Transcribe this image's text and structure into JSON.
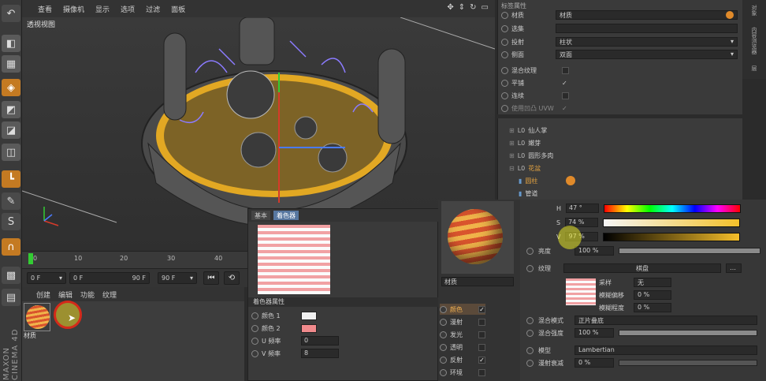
{
  "viewport": {
    "menu": [
      "查看",
      "摄像机",
      "显示",
      "选项",
      "过滤",
      "面板"
    ],
    "label": "透视视图"
  },
  "timeline": {
    "ticks": [
      "0",
      "10",
      "20",
      "30",
      "40"
    ],
    "start_field": "0 F",
    "mid_field_left": "0 F",
    "mid_field_right": "90 F",
    "end_field": "90 F"
  },
  "material_manager": {
    "menu": [
      "创建",
      "编辑",
      "功能",
      "纹理"
    ],
    "material_name": "材质"
  },
  "shader": {
    "tabs": [
      "基本",
      "着色器"
    ],
    "section": "着色器属性",
    "rows": [
      {
        "label": "颜色 1",
        "color": "#f0f0f0"
      },
      {
        "label": "颜色 2",
        "color": "#f08a8c"
      },
      {
        "label": "U 频率",
        "value": "0"
      },
      {
        "label": "V 频率",
        "value": "8"
      }
    ]
  },
  "mat_editor": {
    "name": "材质",
    "channels": [
      {
        "label": "颜色",
        "checked": "✓"
      },
      {
        "label": "漫射",
        "checked": ""
      },
      {
        "label": "发光",
        "checked": ""
      },
      {
        "label": "透明",
        "checked": ""
      },
      {
        "label": "反射",
        "checked": "✓"
      },
      {
        "label": "环境",
        "checked": ""
      }
    ]
  },
  "color_settings": {
    "h_label": "H",
    "h_value": "47 °",
    "s_label": "S",
    "s_value": "74 %",
    "v_label": "V",
    "v_value": "97 %",
    "brightness_label": "亮度",
    "brightness_value": "100 %",
    "brightness_level": 1.0,
    "texture_label": "纹理",
    "texture_value": "棋盘",
    "sampling_label": "采样",
    "sampling_value": "无",
    "blur_offset_label": "模糊偏移",
    "blur_offset_value": "0 %",
    "blur_scale_label": "模糊程度",
    "blur_scale_value": "0 %",
    "mix_mode_label": "混合模式",
    "mix_mode_value": "正片叠底",
    "mix_strength_label": "混合强度",
    "mix_strength_value": "100 %",
    "mix_strength_level": 1.0,
    "model_label": "模型",
    "model_value": "Lambertian",
    "diffuse_falloff_label": "漫射衰减",
    "diffuse_falloff_value": "0 %"
  },
  "attributes": {
    "header": "标签属性",
    "material_label": "材质",
    "material_value": "材质",
    "selection_label": "选集",
    "projection_label": "投射",
    "projection_value": "柱状",
    "side_label": "侧面",
    "side_value": "双面",
    "mix_texture_label": "混合纹理",
    "tile_label": "平铺",
    "tile_checked": "✓",
    "seamless_label": "连续",
    "uvw_label": "使用凹凸 UVW",
    "uvw_checked": "✓"
  },
  "objects": [
    {
      "name": "仙人掌",
      "indent": 0
    },
    {
      "name": "嫩芽",
      "indent": 0
    },
    {
      "name": "圆形多肉",
      "indent": 0
    },
    {
      "name": "花盆",
      "indent": 0
    },
    {
      "name": "圆柱",
      "indent": 1
    },
    {
      "name": "管道",
      "indent": 1
    }
  ],
  "side_tabs": [
    "对象",
    "内容浏览器",
    "层"
  ],
  "brand": "MAXON CINEMA 4D"
}
